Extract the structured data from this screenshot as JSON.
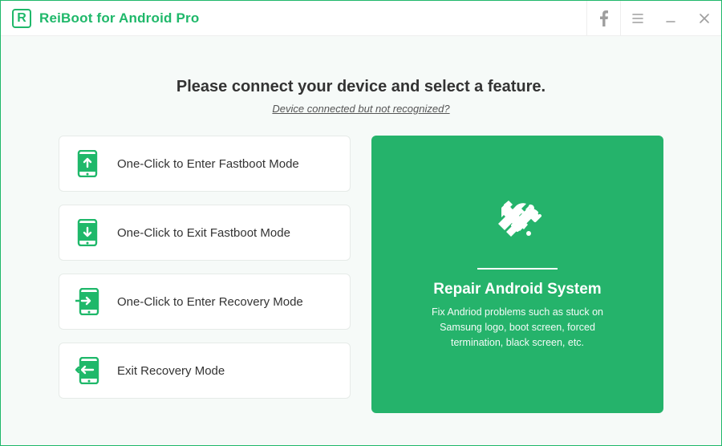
{
  "titlebar": {
    "app_title": "ReiBoot for Android Pro"
  },
  "header": {
    "heading": "Please connect your device and select a feature.",
    "help_link": "Device connected but not recognized?"
  },
  "options": [
    {
      "label": "One-Click to Enter Fastboot Mode"
    },
    {
      "label": "One-Click to Exit Fastboot Mode"
    },
    {
      "label": "One-Click to Enter Recovery Mode"
    },
    {
      "label": "Exit Recovery Mode"
    }
  ],
  "repair_panel": {
    "title": "Repair Android System",
    "description": "Fix Andriod problems such as stuck on Samsung logo, boot screen, forced termination, black screen, etc."
  },
  "colors": {
    "brand": "#1fb86a",
    "panel": "#25b36b"
  }
}
